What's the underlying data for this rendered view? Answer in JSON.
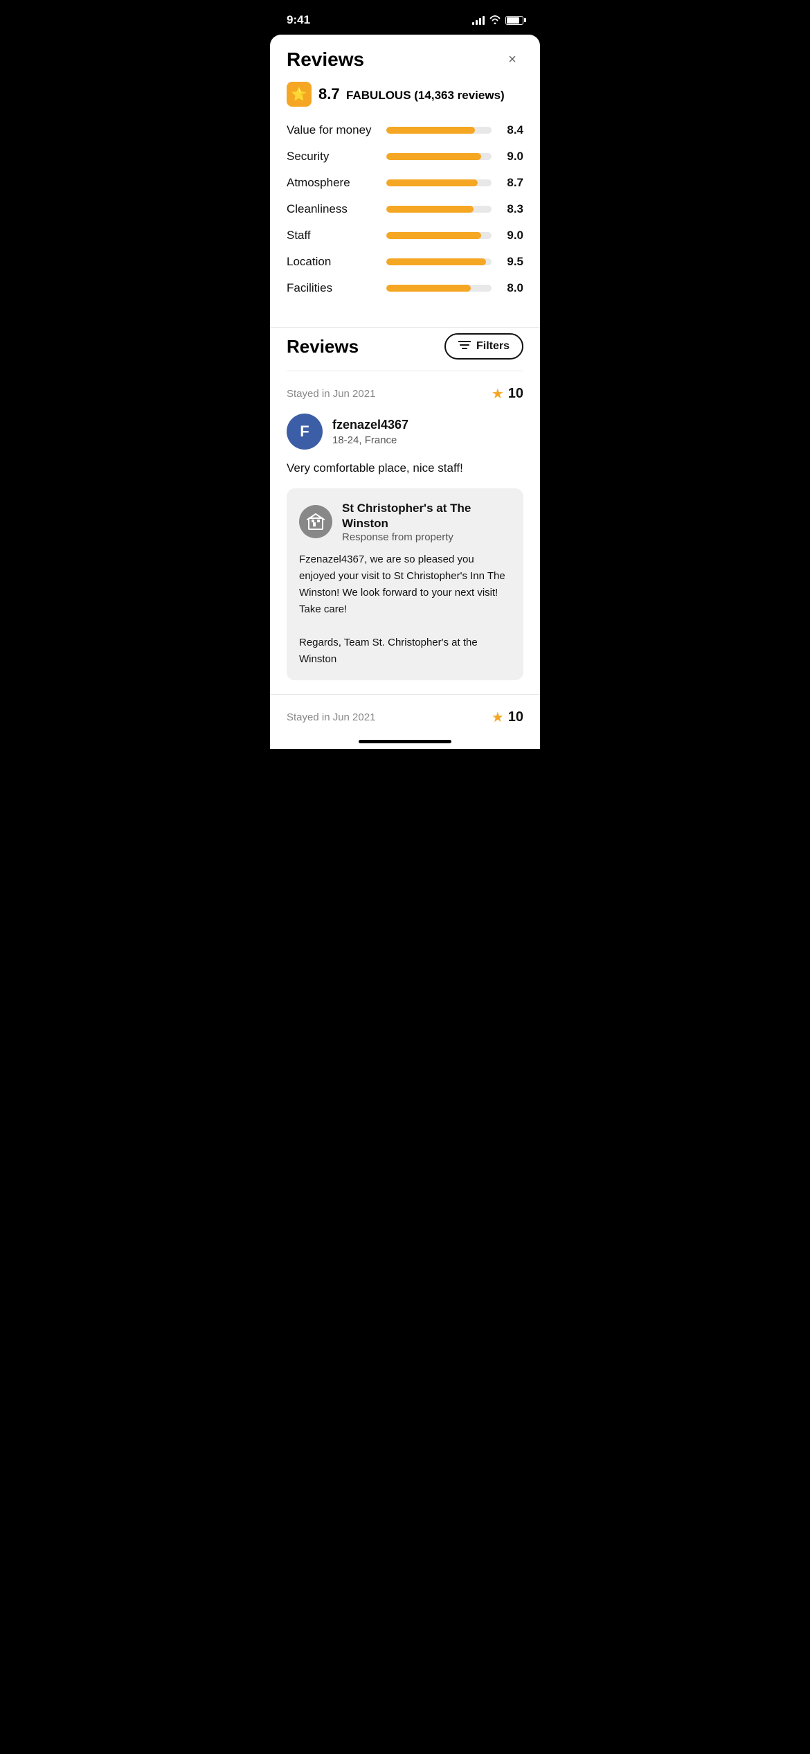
{
  "statusBar": {
    "time": "9:41",
    "signalBars": [
      4,
      6,
      8,
      10,
      12
    ],
    "batteryLevel": 80
  },
  "modal": {
    "title": "Reviews",
    "closeLabel": "×"
  },
  "overallRating": {
    "score": "8.7",
    "label": "FABULOUS (14,363 reviews)"
  },
  "categories": [
    {
      "label": "Value for money",
      "value": "8.4",
      "percent": 84
    },
    {
      "label": "Security",
      "value": "9.0",
      "percent": 90
    },
    {
      "label": "Atmosphere",
      "value": "8.7",
      "percent": 87
    },
    {
      "label": "Cleanliness",
      "value": "8.3",
      "percent": 83
    },
    {
      "label": "Staff",
      "value": "9.0",
      "percent": 90
    },
    {
      "label": "Location",
      "value": "9.5",
      "percent": 95
    },
    {
      "label": "Facilities",
      "value": "8.0",
      "percent": 80
    }
  ],
  "reviewsSectionTitle": "Reviews",
  "filtersButton": "Filters",
  "reviews": [
    {
      "date": "Stayed in Jun 2021",
      "score": "10",
      "avatarLetter": "F",
      "avatarColor": "#3b5ea6",
      "name": "fzenazel4367",
      "location": "18-24, France",
      "text": "Very comfortable place, nice staff!",
      "response": {
        "propertyName": "St Christopher's at The Winston",
        "responseFrom": "Response from property",
        "text": "Fzenazel4367, we are so pleased you enjoyed your visit to St Christopher's Inn The Winston! We look forward to your next visit! Take care!\n\nRegards, Team St. Christopher's at the Winston"
      }
    }
  ],
  "bottomPreview": {
    "date": "Stayed in Jun 2021",
    "score": "10"
  },
  "colors": {
    "accent": "#f5a623",
    "barBackground": "#e8e8e8"
  }
}
